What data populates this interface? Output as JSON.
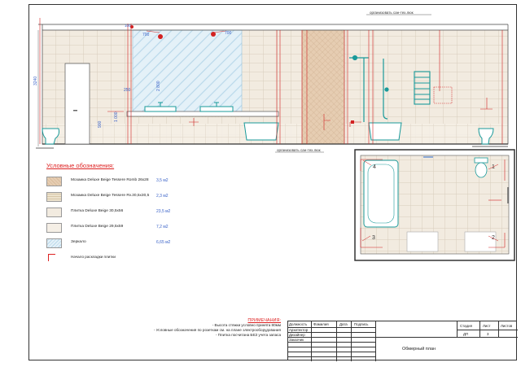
{
  "elevation": {
    "dimensions": {
      "height_total": "3240",
      "mirror_height": "2 800",
      "tap_height": "250",
      "basin_height": "1 000",
      "bench_height": "900",
      "sockets_offset_a": "700",
      "sockets_offset_b": "700",
      "top_offset": "100"
    },
    "annotations": {
      "hatch_top": "организовать сан-тех.люк",
      "hatch_bottom": "организовать сан-тех.люк"
    }
  },
  "legend": {
    "title": "Условные обозначения:",
    "items": [
      {
        "label": "Мозаика Deluxe Beige Tessere Romb 26х28",
        "area": "3,5 м2",
        "color": "#e6cdb2"
      },
      {
        "label": "Мозаика Deluxe Beige Tessere Rv.30,5х30,5",
        "area": "2,3 м2",
        "color": "#ede2cc"
      },
      {
        "label": "Плитка Deluxe Beige 30,5х56",
        "area": "23,5 м2",
        "color": "#f2ebe0"
      },
      {
        "label": "Плитка Deluxe Beige 29,5х59",
        "area": "7,2 м2",
        "color": "#f5efe6"
      },
      {
        "label": "Зеркало",
        "area": "6,65 м2",
        "color": "#dfeef7"
      }
    ],
    "start_label": "Начало раскладки плитки"
  },
  "plan": {
    "markers": [
      "1",
      "2",
      "3",
      "4"
    ]
  },
  "notes": {
    "title": "ПРИМЕЧАНИЯ:",
    "lines": [
      "- Высота стяжки условно принята 80мм",
      "- Условные обозначения по розеткам см. на плане электрооборудования",
      "- Плитка посчитана БЕЗ учета запаса"
    ]
  },
  "title_block": {
    "headers": [
      "Должность",
      "Фамилия",
      "Дата",
      "Подпись"
    ],
    "roles": [
      "Архитектор",
      "Дизайнер",
      "Заказчик"
    ],
    "stage_label": "Стадия",
    "stage_value": "ДП",
    "sheet_label": "Лист",
    "sheet_value": "3",
    "sheets_label": "Листов",
    "sheets_value": "",
    "drawing_title": "Обмерный план"
  },
  "colors": {
    "accent_red": "#d22222",
    "dimension_blue": "#3a62c8",
    "fixture_teal": "#1a9a9a",
    "tile_beige": "#f2ebe0",
    "mosaic": "#e6cdb2",
    "mirror": "#dfeef7"
  }
}
